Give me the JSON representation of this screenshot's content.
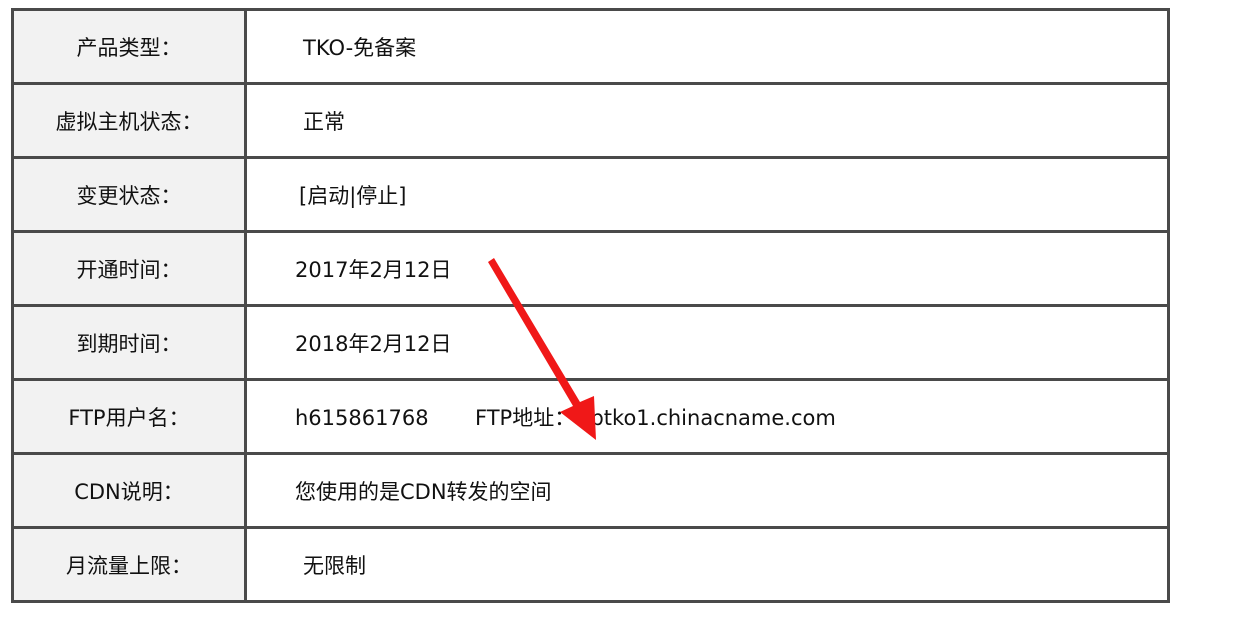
{
  "rows": [
    {
      "label": "产品类型：",
      "value": "TKO-免备案"
    },
    {
      "label": "虚拟主机状态：",
      "value": "正常"
    },
    {
      "label": "变更状态：",
      "value": "[启动|停止]"
    },
    {
      "label": "开通时间：",
      "value": "2017年2月12日"
    },
    {
      "label": "到期时间：",
      "value": "2018年2月12日"
    },
    {
      "label": "FTP用户名：",
      "value": "h615861768",
      "extra_label": "FTP地址：",
      "extra_value": "ftptko1.chinacname.com"
    },
    {
      "label": "CDN说明：",
      "value": "您使用的是CDN转发的空间"
    },
    {
      "label": "月流量上限：",
      "value": "无限制"
    }
  ],
  "arrow_color": "#f01818"
}
